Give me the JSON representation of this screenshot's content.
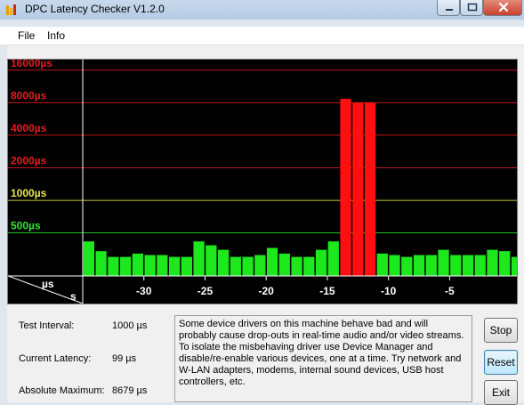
{
  "window": {
    "title": "DPC Latency Checker V1.2.0",
    "background": "#dfe6ee",
    "controls": [
      "minimize-icon",
      "maximize-icon",
      "close-icon"
    ]
  },
  "menu": {
    "items": [
      {
        "label": "File"
      },
      {
        "label": "Info"
      }
    ]
  },
  "chart_data": {
    "type": "bar",
    "y_axis_labels": [
      {
        "text": "16000µs",
        "value": 16000,
        "color": "#e31c1c"
      },
      {
        "text": "8000µs",
        "value": 8000,
        "color": "#e31c1c"
      },
      {
        "text": "4000µs",
        "value": 4000,
        "color": "#e31c1c"
      },
      {
        "text": "2000µs",
        "value": 2000,
        "color": "#e31c1c"
      },
      {
        "text": "1000µs",
        "value": 1000,
        "color": "#e8e84a"
      },
      {
        "text": "500µs",
        "value": 500,
        "color": "#2ee82e"
      }
    ],
    "y_scale": "log",
    "ylim": [
      200,
      20000
    ],
    "x_ticks": [
      {
        "text": "-30",
        "value": -30
      },
      {
        "text": "-25",
        "value": -25
      },
      {
        "text": "-20",
        "value": -20
      },
      {
        "text": "-15",
        "value": -15
      },
      {
        "text": "-10",
        "value": -10
      },
      {
        "text": "-5",
        "value": -5
      }
    ],
    "xlim": [
      -34.5,
      0
    ],
    "corner_labels": {
      "y_unit": "µs",
      "x_unit": "s"
    },
    "x": [
      -34,
      -33,
      -32,
      -31,
      -30,
      -29,
      -28,
      -27,
      -26,
      -25,
      -24,
      -23,
      -22,
      -21,
      -20,
      -19,
      -18,
      -17,
      -16,
      -15,
      -14,
      -13,
      -12,
      -11,
      -10,
      -9,
      -8,
      -7,
      -6,
      -5,
      -4,
      -3,
      -2,
      -1,
      0
    ],
    "values": [
      417,
      339,
      300,
      300,
      322,
      312,
      312,
      300,
      300,
      417,
      384,
      349,
      300,
      300,
      312,
      363,
      322,
      300,
      300,
      349,
      417,
      8679,
      8000,
      8000,
      322,
      312,
      300,
      312,
      312,
      349,
      312,
      312,
      312,
      349,
      339,
      300
    ],
    "colors": {
      "normal": "#1de81d",
      "high": "#ff0f0f",
      "background": "#000000"
    },
    "threshold_red_above": 2000
  },
  "info": {
    "test_interval_label": "Test Interval:",
    "test_interval_value": "1000 µs",
    "current_latency_label": "Current Latency:",
    "current_latency_value": "99 µs",
    "absolute_maximum_label": "Absolute Maximum:",
    "absolute_maximum_value": "8679 µs"
  },
  "message": "Some device drivers on this machine behave bad and will probably cause drop-outs in real-time audio and/or video streams. To isolate the misbehaving driver use Device Manager and disable/re-enable various devices, one at a time. Try network and W-LAN adapters, modems, internal sound devices, USB host controllers, etc.",
  "buttons": {
    "stop": "Stop",
    "reset": "Reset",
    "exit": "Exit"
  }
}
